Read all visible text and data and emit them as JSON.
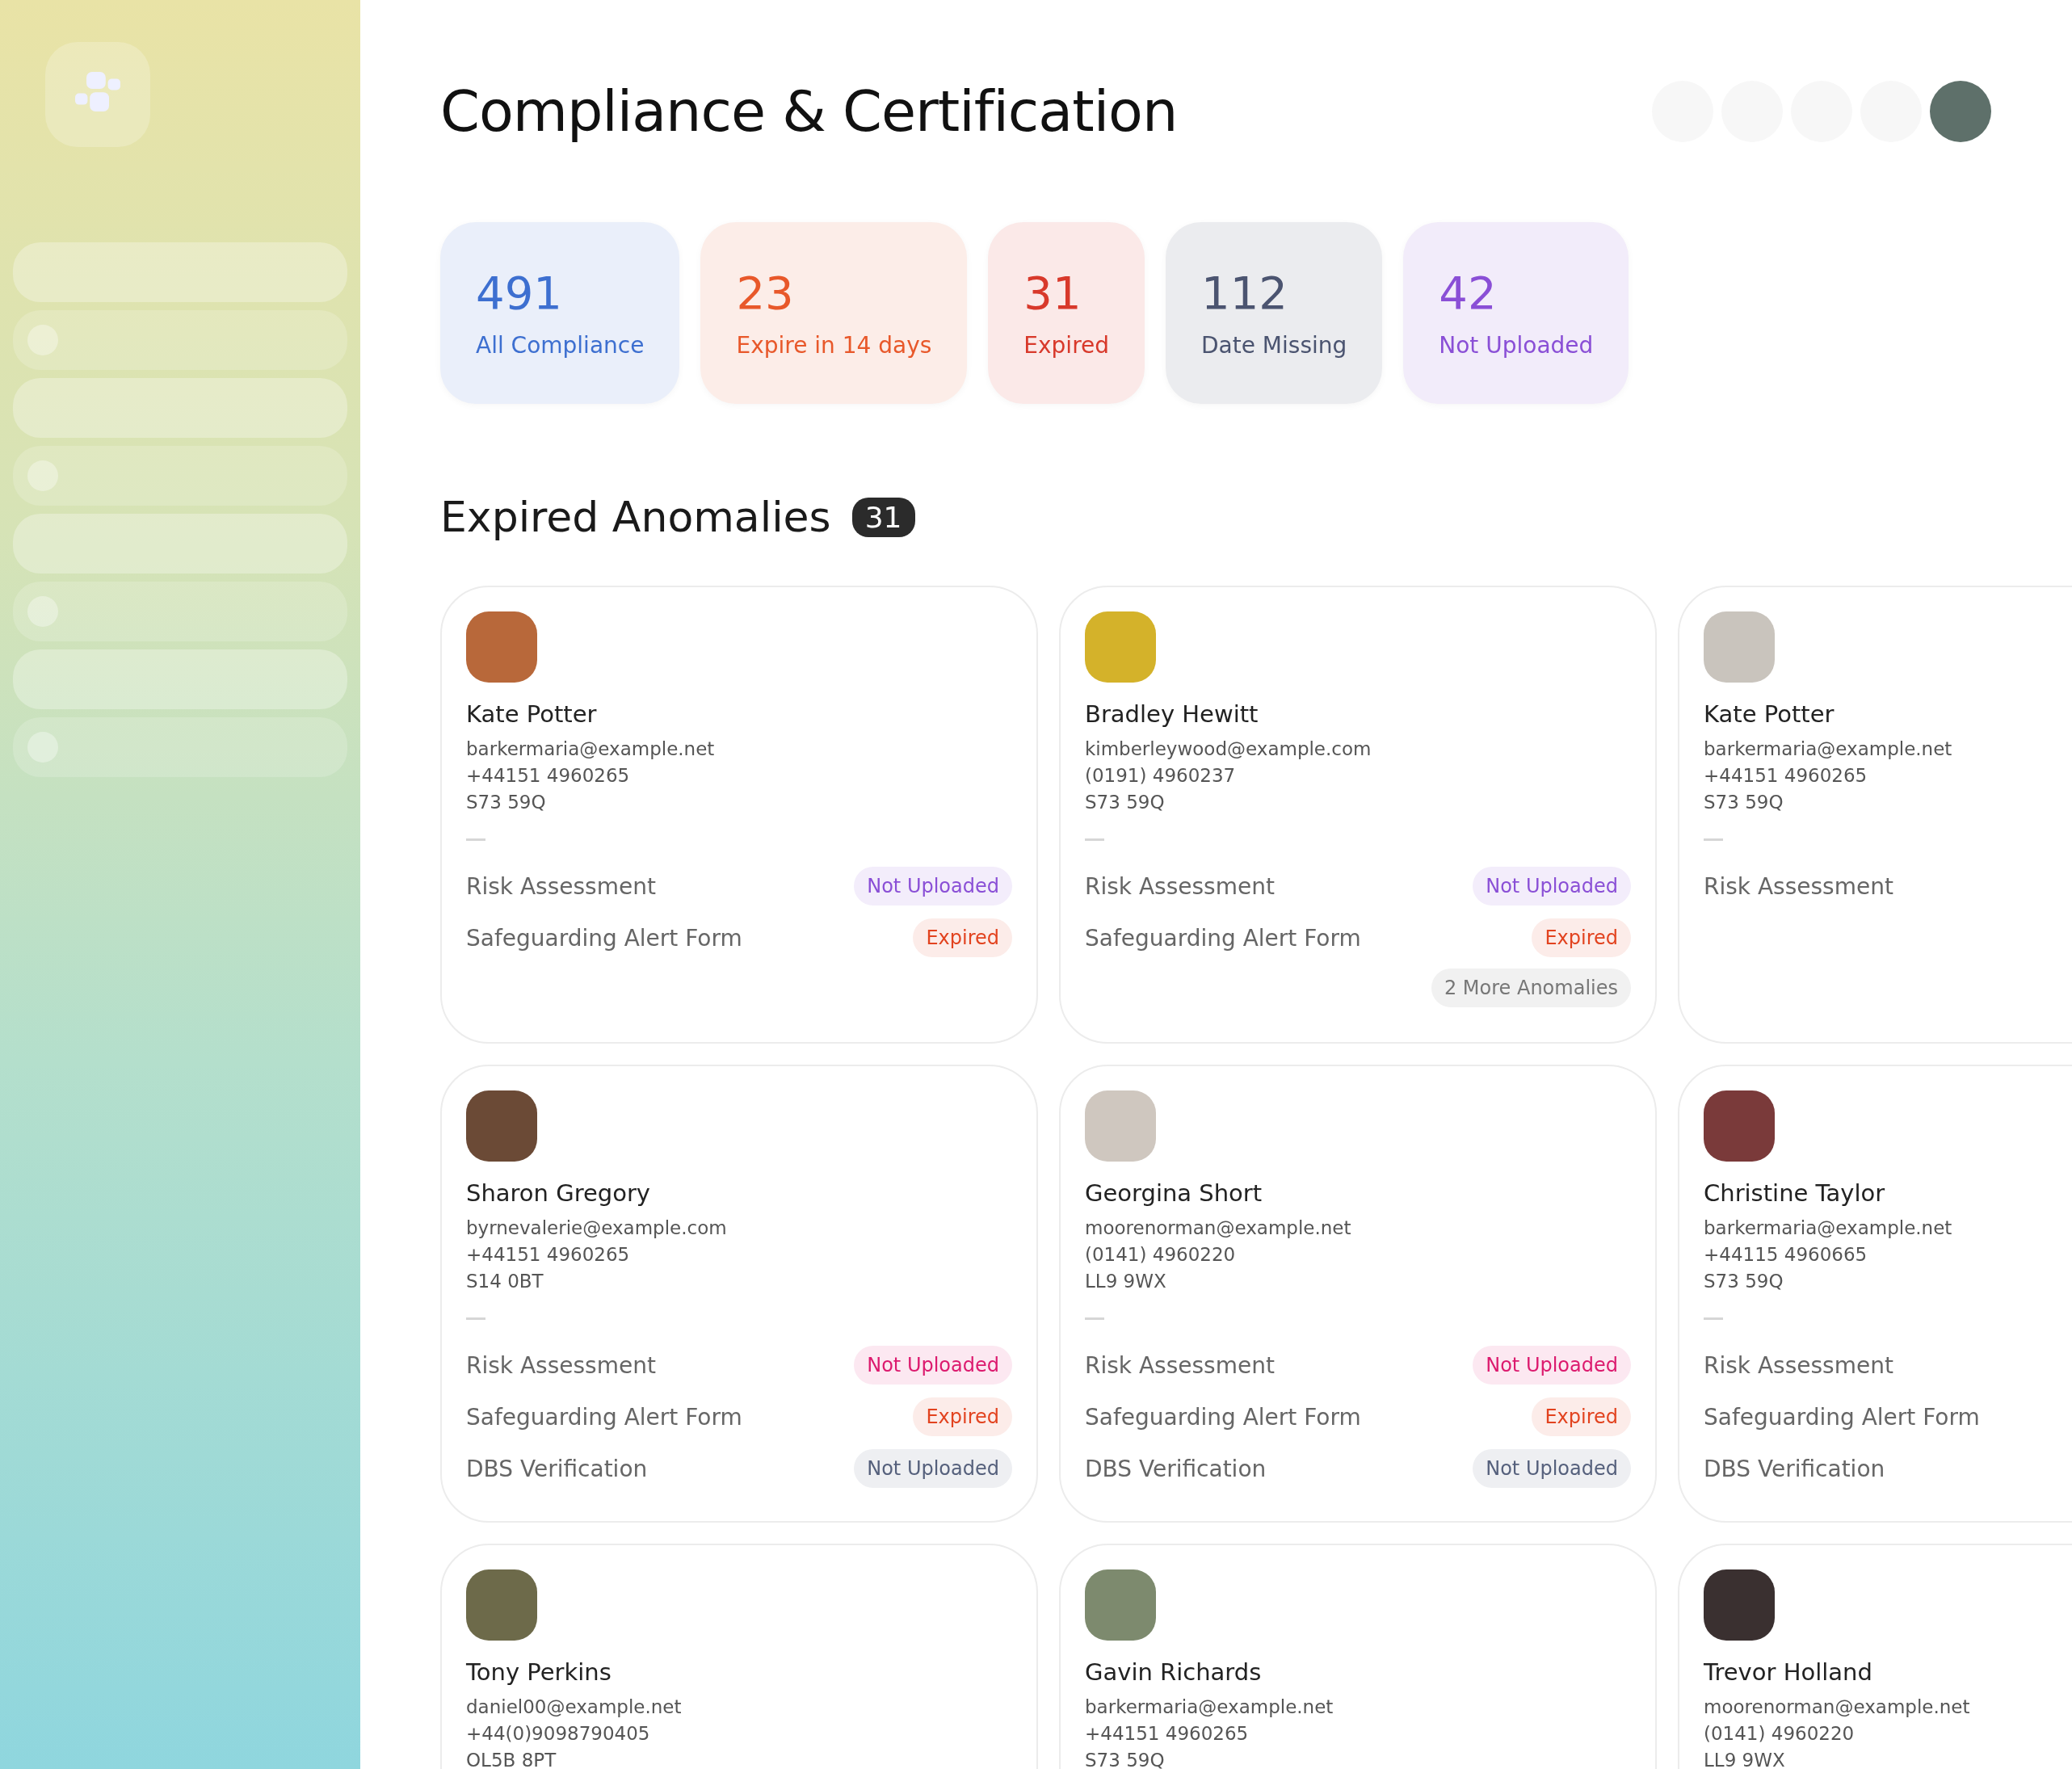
{
  "title": "Compliance & Certification",
  "stats": [
    {
      "value": "491",
      "label": "All Compliance",
      "color": "#3d6fd0"
    },
    {
      "value": "23",
      "label": "Expire in 14 days",
      "color": "#e8582a"
    },
    {
      "value": "31",
      "label": "Expired",
      "color": "#d8392b"
    },
    {
      "value": "112",
      "label": "Date Missing",
      "color": "#4b5470"
    },
    {
      "value": "42",
      "label": "Not Uploaded",
      "color": "#8a4fd6"
    }
  ],
  "section": {
    "title": "Expired Anomalies",
    "count": "31"
  },
  "cards": [
    {
      "name": "Kate Potter",
      "email": "barkermaria@example.net",
      "phone": "+44151 4960265",
      "postcode": "S73 59Q",
      "items": [
        {
          "label": "Risk Assessment",
          "status": "Not Uploaded",
          "color": "#8a4fd6"
        },
        {
          "label": "Safeguarding Alert Form",
          "status": "Expired",
          "color": "#e2431f"
        }
      ]
    },
    {
      "name": "Bradley Hewitt",
      "email": "kimberleywood@example.com",
      "phone": "(0191) 4960237",
      "postcode": "S73 59Q",
      "items": [
        {
          "label": "Risk Assessment",
          "status": "Not Uploaded",
          "color": "#8a4fd6"
        },
        {
          "label": "Safeguarding Alert Form",
          "status": "Expired",
          "color": "#e2431f"
        }
      ],
      "more": "2 More Anomalies"
    },
    {
      "name": "Kate Potter",
      "email": "barkermaria@example.net",
      "phone": "+44151 4960265",
      "postcode": "S73 59Q",
      "items": [
        {
          "label": "Risk Assessment"
        }
      ]
    },
    {
      "name": "Sharon Gregory",
      "email": "byrnevalerie@example.com",
      "phone": "+44151 4960265",
      "postcode": "S14 0BT",
      "items": [
        {
          "label": "Risk Assessment",
          "status": "Not Uploaded",
          "color": "#dc1a6e"
        },
        {
          "label": "Safeguarding Alert Form",
          "status": "Expired",
          "color": "#e2431f"
        },
        {
          "label": "DBS Verification",
          "status": "Not Uploaded",
          "color": "#55607c"
        }
      ]
    },
    {
      "name": "Georgina Short",
      "email": "moorenorman@example.net",
      "phone": "(0141) 4960220",
      "postcode": "LL9 9WX",
      "items": [
        {
          "label": "Risk Assessment",
          "status": "Not Uploaded",
          "color": "#dc1a6e"
        },
        {
          "label": "Safeguarding Alert Form",
          "status": "Expired",
          "color": "#e2431f"
        },
        {
          "label": "DBS Verification",
          "status": "Not Uploaded",
          "color": "#55607c"
        }
      ]
    },
    {
      "name": "Christine Taylor",
      "email": "barkermaria@example.net",
      "phone": "+44115 4960665",
      "postcode": "S73 59Q",
      "items": [
        {
          "label": "Risk Assessment"
        },
        {
          "label": "Safeguarding Alert Form"
        },
        {
          "label": "DBS Verification"
        }
      ]
    },
    {
      "name": "Tony Perkins",
      "email": "daniel00@example.net",
      "phone": "+44(0)9098790405",
      "postcode": "OL5B 8PT"
    },
    {
      "name": "Gavin Richards",
      "email": "barkermaria@example.net",
      "phone": "+44151 4960265",
      "postcode": "S73 59Q"
    },
    {
      "name": "Trevor Holland",
      "email": "moorenorman@example.net",
      "phone": "(0141) 4960220",
      "postcode": "LL9 9WX"
    }
  ]
}
